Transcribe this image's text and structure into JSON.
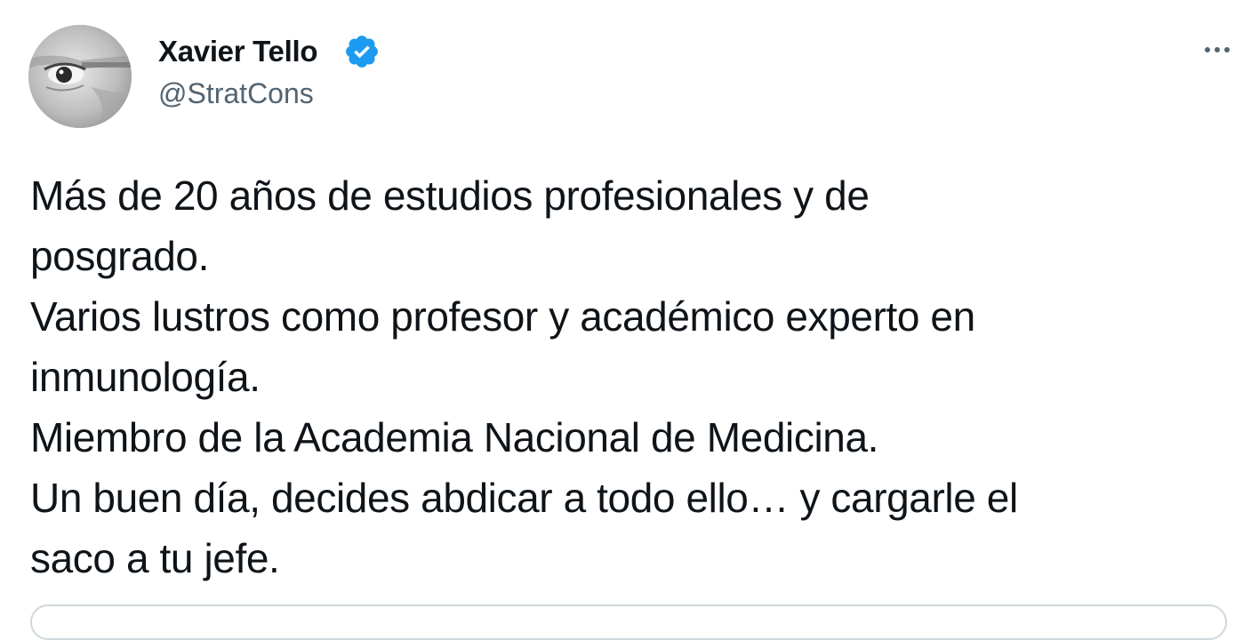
{
  "author": {
    "name": "Xavier Tello",
    "handle": "@StratCons",
    "verified": true,
    "avatar_icon": "avatar-photo"
  },
  "menu": {
    "icon": "more-horizontal-icon"
  },
  "tweet": {
    "lines": [
      "Más de 20 años de estudios profesionales y de",
      "posgrado.",
      "Varios lustros como profesor y académico experto en",
      "inmunología.",
      "Miembro de la Academia Nacional de Medicina.",
      "Un buen día, decides abdicar a todo ello… y cargarle el",
      "saco a tu jefe."
    ]
  },
  "colors": {
    "text": "#0f1419",
    "secondary": "#536471",
    "verified": "#1d9bf0",
    "border": "#cfd9de"
  }
}
